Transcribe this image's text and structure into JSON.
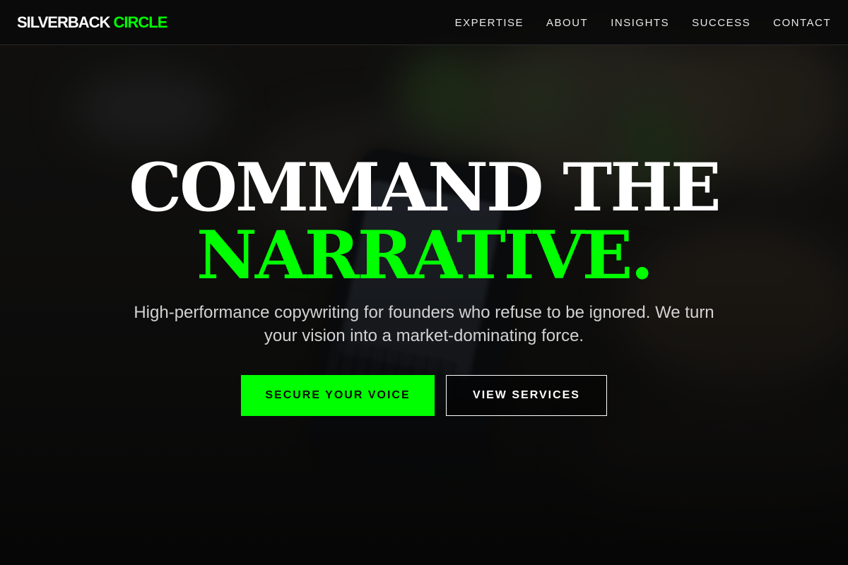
{
  "colors": {
    "accent": "#00ff00",
    "text_primary": "#ffffff",
    "navbar_bg": "#0a0a0a"
  },
  "header": {
    "logo_part1": "SILVERBACK",
    "logo_part2": "CIRCLE",
    "nav_items": [
      {
        "label": "EXPERTISE"
      },
      {
        "label": "ABOUT"
      },
      {
        "label": "INSIGHTS"
      },
      {
        "label": "SUCCESS"
      },
      {
        "label": "CONTACT"
      }
    ]
  },
  "hero": {
    "headline_line1": "COMMAND THE",
    "headline_line2": "NARRATIVE.",
    "subtitle": "High-performance copywriting for founders who refuse to be ignored. We turn your vision into a market-dominating force.",
    "primary_button": "SECURE YOUR VOICE",
    "secondary_button": "VIEW SERVICES"
  }
}
